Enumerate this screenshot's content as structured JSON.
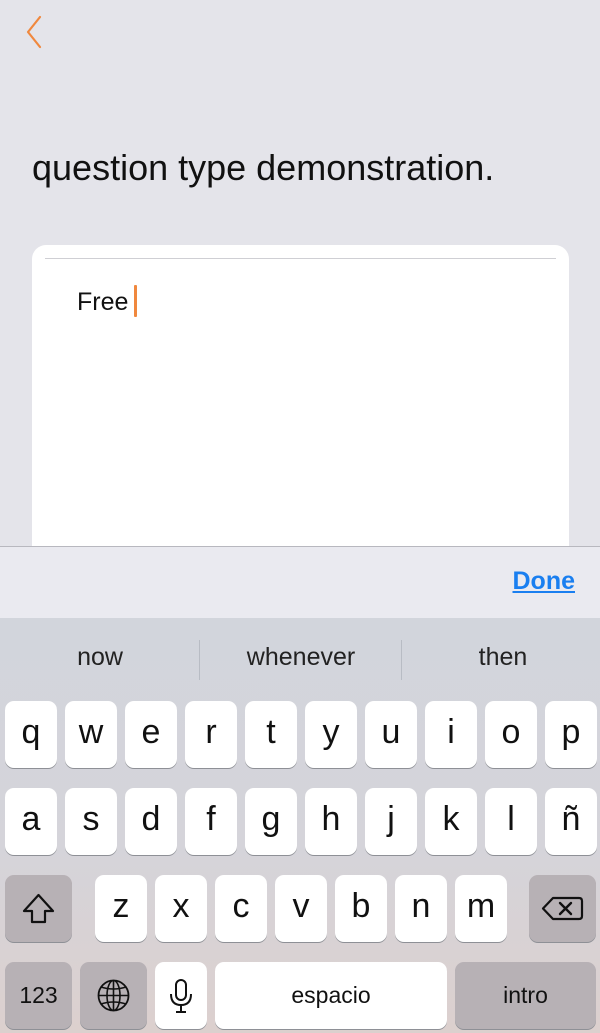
{
  "nav": {
    "back_icon": "chevron-left-icon",
    "accent_color": "#f0883e"
  },
  "question": {
    "title": "question type demonstration."
  },
  "answer": {
    "value": "Free"
  },
  "accessory": {
    "done_label": "Done",
    "done_color": "#1a7ff0"
  },
  "keyboard": {
    "predictions": [
      "now",
      "whenever",
      "then"
    ],
    "row1": [
      "q",
      "w",
      "e",
      "r",
      "t",
      "y",
      "u",
      "i",
      "o",
      "p"
    ],
    "row2": [
      "a",
      "s",
      "d",
      "f",
      "g",
      "h",
      "j",
      "k",
      "l",
      "ñ"
    ],
    "row3": [
      "z",
      "x",
      "c",
      "v",
      "b",
      "n",
      "m"
    ],
    "shift_icon": "shift-icon",
    "delete_icon": "delete-icon",
    "numbers_label": "123",
    "globe_icon": "globe-icon",
    "mic_icon": "microphone-icon",
    "space_label": "espacio",
    "return_label": "intro"
  }
}
